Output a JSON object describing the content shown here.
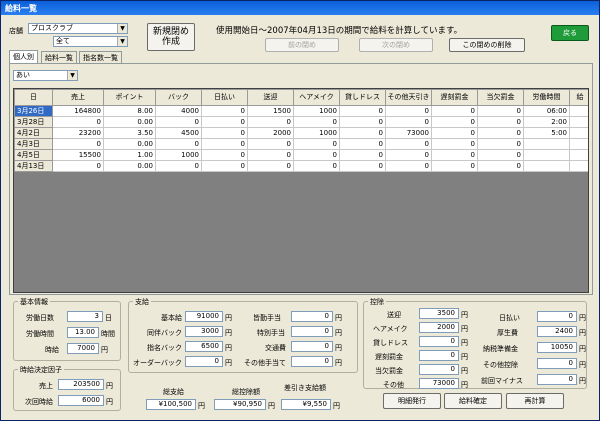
{
  "window": {
    "title": "給料一覧"
  },
  "header": {
    "store_label": "店舗",
    "store_value": "プロスクラブ",
    "store_sub_value": "全て",
    "new_close_button": "新規閉め作成",
    "period_message": "使用開始日～2007年04月13日の期間で給料を計算しています。",
    "prev_close_button": "前の閉め",
    "next_close_button": "次の閉め",
    "delete_close_button": "この閉めの削除",
    "back_button": "戻る"
  },
  "tabs": [
    "個人別",
    "給料一覧",
    "指名数一覧"
  ],
  "filter": {
    "person_value": "あい"
  },
  "grid": {
    "headers": [
      "日",
      "売上",
      "ポイント",
      "バック",
      "日払い",
      "送迎",
      "ヘアメイク",
      "貸しドレス",
      "その他天引き",
      "遅刻罰金",
      "当欠罰金",
      "労働時間",
      "給"
    ],
    "rows": [
      [
        "3月26日",
        "164800",
        "8.00",
        "4000",
        "0",
        "1500",
        "1000",
        "0",
        "0",
        "0",
        "0",
        "06:00"
      ],
      [
        "3月28日",
        "0",
        "0.00",
        "0",
        "0",
        "0",
        "0",
        "0",
        "0",
        "0",
        "0",
        "2:00"
      ],
      [
        "4月2日",
        "23200",
        "3.50",
        "4500",
        "0",
        "2000",
        "1000",
        "0",
        "73000",
        "0",
        "0",
        "5:00"
      ],
      [
        "4月3日",
        "0",
        "0.00",
        "0",
        "0",
        "0",
        "0",
        "0",
        "0",
        "0",
        "0",
        ""
      ],
      [
        "4月5日",
        "15500",
        "1.00",
        "1000",
        "0",
        "0",
        "0",
        "0",
        "0",
        "0",
        "0",
        ""
      ],
      [
        "4月13日",
        "0",
        "0.00",
        "0",
        "0",
        "0",
        "0",
        "0",
        "0",
        "0",
        "0",
        ""
      ]
    ]
  },
  "basic": {
    "title": "基本情報",
    "work_days_label": "労働日数",
    "work_days_value": "3",
    "work_days_unit": "日",
    "work_hours_label": "労働時間",
    "work_hours_value": "13.00",
    "work_hours_unit": "時間",
    "hourly_label": "時給",
    "hourly_value": "7000",
    "hourly_unit": "円"
  },
  "hourly_factor": {
    "title": "時給決定因子",
    "sales_label": "売上",
    "sales_value": "203500",
    "sales_unit": "円",
    "next_hourly_label": "次回時給",
    "next_hourly_value": "6000",
    "next_hourly_unit": "円"
  },
  "payment": {
    "title": "支給",
    "base_label": "基本給",
    "base_value": "91000",
    "dohan_label": "同伴バック",
    "dohan_value": "3000",
    "shimei_label": "指名バック",
    "shimei_value": "6500",
    "order_label": "オーダーバック",
    "order_value": "0",
    "attend_label": "皆勤手当",
    "attend_value": "0",
    "special_label": "特別手当",
    "special_value": "0",
    "transport_label": "交通費",
    "transport_value": "0",
    "other_label": "その他手当て",
    "other_value": "0",
    "unit": "円"
  },
  "deduction": {
    "title": "控除",
    "pickup_label": "送迎",
    "pickup_value": "3500",
    "hair_label": "ヘアメイク",
    "hair_value": "2000",
    "dress_label": "貸しドレス",
    "dress_value": "0",
    "late_label": "遅刻罰金",
    "late_value": "0",
    "absent_label": "当欠罰金",
    "absent_value": "0",
    "other_label": "その他",
    "other_value": "73000",
    "daily_label": "日払い",
    "daily_value": "0",
    "welfare_label": "厚生費",
    "welfare_value": "2400",
    "tax_label": "納税準備金",
    "tax_value": "10050",
    "other_ded_label": "その他控除",
    "other_ded_value": "0",
    "prev_minus_label": "前回マイナス",
    "prev_minus_value": "0",
    "unit": "円"
  },
  "totals": {
    "total_pay_label": "総支給",
    "total_pay_value": "¥100,500",
    "total_ded_label": "総控除額",
    "total_ded_value": "¥90,950",
    "net_label": "差引き支給額",
    "net_value": "¥9,550",
    "unit": "円"
  },
  "actions": {
    "statement_button": "明細発行",
    "confirm_button": "給料確定",
    "recalc_button": "再計算"
  }
}
